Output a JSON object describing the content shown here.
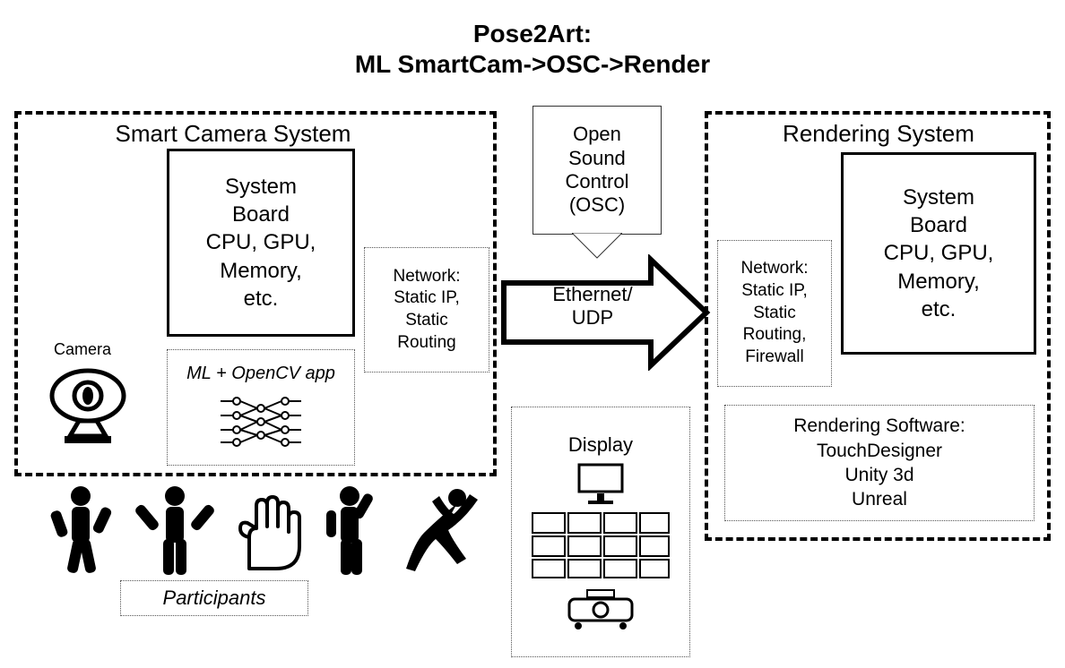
{
  "title_line1": "Pose2Art:",
  "title_line2": "ML SmartCam->OSC->Render",
  "smart_camera": {
    "heading": "Smart Camera System",
    "system_board": "System\nBoard\nCPU, GPU,\nMemory,\netc.",
    "camera_label": "Camera",
    "ml_app": "ML + OpenCV app",
    "network": "Network:\nStatic IP,\nStatic\nRouting"
  },
  "participants_label": "Participants",
  "osc": {
    "label": "Open\nSound\nControl\n(OSC)",
    "arrow_label": "Ethernet/\nUDP"
  },
  "display_label": "Display",
  "rendering": {
    "heading": "Rendering System",
    "system_board": "System\nBoard\nCPU, GPU,\nMemory,\netc.",
    "network": "Network:\nStatic IP,\nStatic\nRouting,\nFirewall",
    "software": "Rendering Software:\nTouchDesigner\nUnity 3d\nUnreal"
  }
}
